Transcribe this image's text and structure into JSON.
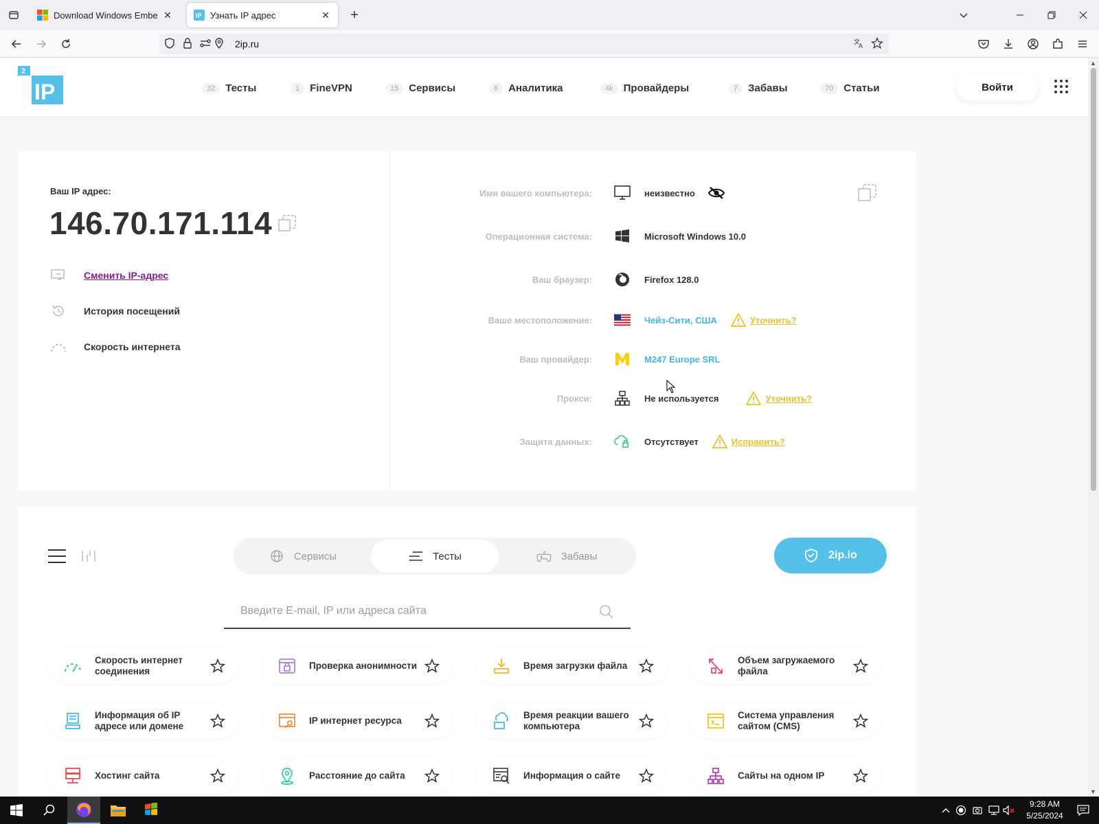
{
  "browser": {
    "tabs": [
      {
        "title": "Download Windows Embedded",
        "active": false
      },
      {
        "title": "Узнать IP адрес",
        "active": true
      }
    ],
    "url": "2ip.ru"
  },
  "site": {
    "logo_text": "IP",
    "logo_badge": "2",
    "menu": [
      {
        "count": "32",
        "label": "Тесты"
      },
      {
        "count": "1",
        "label": "FineVPN"
      },
      {
        "count": "15",
        "label": "Сервисы"
      },
      {
        "count": "6",
        "label": "Аналитика"
      },
      {
        "count": "4k",
        "label": "Провайдеры"
      },
      {
        "count": "7",
        "label": "Забавы"
      },
      {
        "count": "70",
        "label": "Статьи"
      }
    ],
    "login_label": "Войти"
  },
  "ip_info": {
    "label": "Ваш IP адрес:",
    "ip": "146.70.171.114",
    "links": [
      {
        "label": "Сменить IP-адрес",
        "icon": "change-ip-icon"
      },
      {
        "label": "История посещений",
        "icon": "history-icon"
      },
      {
        "label": "Скорость интернета",
        "icon": "speed-icon"
      }
    ],
    "rows": [
      {
        "label": "Имя вашего компьютера:",
        "value": "неизвестно",
        "icon": "monitor-icon"
      },
      {
        "label": "Операционная система:",
        "value": "Microsoft Windows 10.0",
        "icon": "windows-icon"
      },
      {
        "label": "Ваш браузер:",
        "value": "Firefox 128.0",
        "icon": "firefox-icon"
      },
      {
        "label": "Ваше местоположение:",
        "value": "Чейз-Сити, США",
        "icon": "us-flag-icon",
        "warning": "Уточнить?"
      },
      {
        "label": "Ваш провайдер:",
        "value": "M247 Europe SRL",
        "icon": "provider-logo-icon"
      },
      {
        "label": "Прокси:",
        "value": "Не используется",
        "icon": "proxy-icon",
        "warning": "Уточнить?"
      },
      {
        "label": "Защита данных:",
        "value": "Отсутствует",
        "icon": "cloud-lock-icon",
        "warning": "Исправить?"
      }
    ]
  },
  "services": {
    "segments": [
      {
        "label": "Сервисы",
        "active": false
      },
      {
        "label": "Тесты",
        "active": true
      },
      {
        "label": "Забавы",
        "active": false
      }
    ],
    "cta_label": "2ip.io",
    "search_placeholder": "Введите E-mail, IP или адреса сайта",
    "tiles": [
      {
        "label": "Скорость интернет соединения",
        "icon": "speedometer-icon",
        "color": "#2ecc71"
      },
      {
        "label": "Проверка анонимности",
        "icon": "anonymity-icon",
        "color": "#b57bd9"
      },
      {
        "label": "Время загрузки файла",
        "icon": "download-icon",
        "color": "#f1b11e"
      },
      {
        "label": "Объем загружаемого файла",
        "icon": "file-size-icon",
        "color": "#e8456b"
      },
      {
        "label": "Информация об IP адресе или домене",
        "icon": "ip-info-icon",
        "color": "#41b6e6"
      },
      {
        "label": "IP интернет ресурса",
        "icon": "web-resource-icon",
        "color": "#f08a3c"
      },
      {
        "label": "Время реакции вашего компьютера",
        "icon": "ping-icon",
        "color": "#41b6e6"
      },
      {
        "label": "Система управления сайтом (CMS)",
        "icon": "cms-icon",
        "color": "#f1c40f"
      },
      {
        "label": "Хостинг сайта",
        "icon": "hosting-icon",
        "color": "#e84545"
      },
      {
        "label": "Расстояние до сайта",
        "icon": "location-pin-icon",
        "color": "#2ecc9a"
      },
      {
        "label": "Информация о сайте",
        "icon": "site-info-icon",
        "color": "#444444"
      },
      {
        "label": "Сайты на одном IP",
        "icon": "sitemap-icon",
        "color": "#b83bb8"
      }
    ]
  },
  "taskbar": {
    "time": "9:28 AM",
    "date": "5/25/2024"
  }
}
